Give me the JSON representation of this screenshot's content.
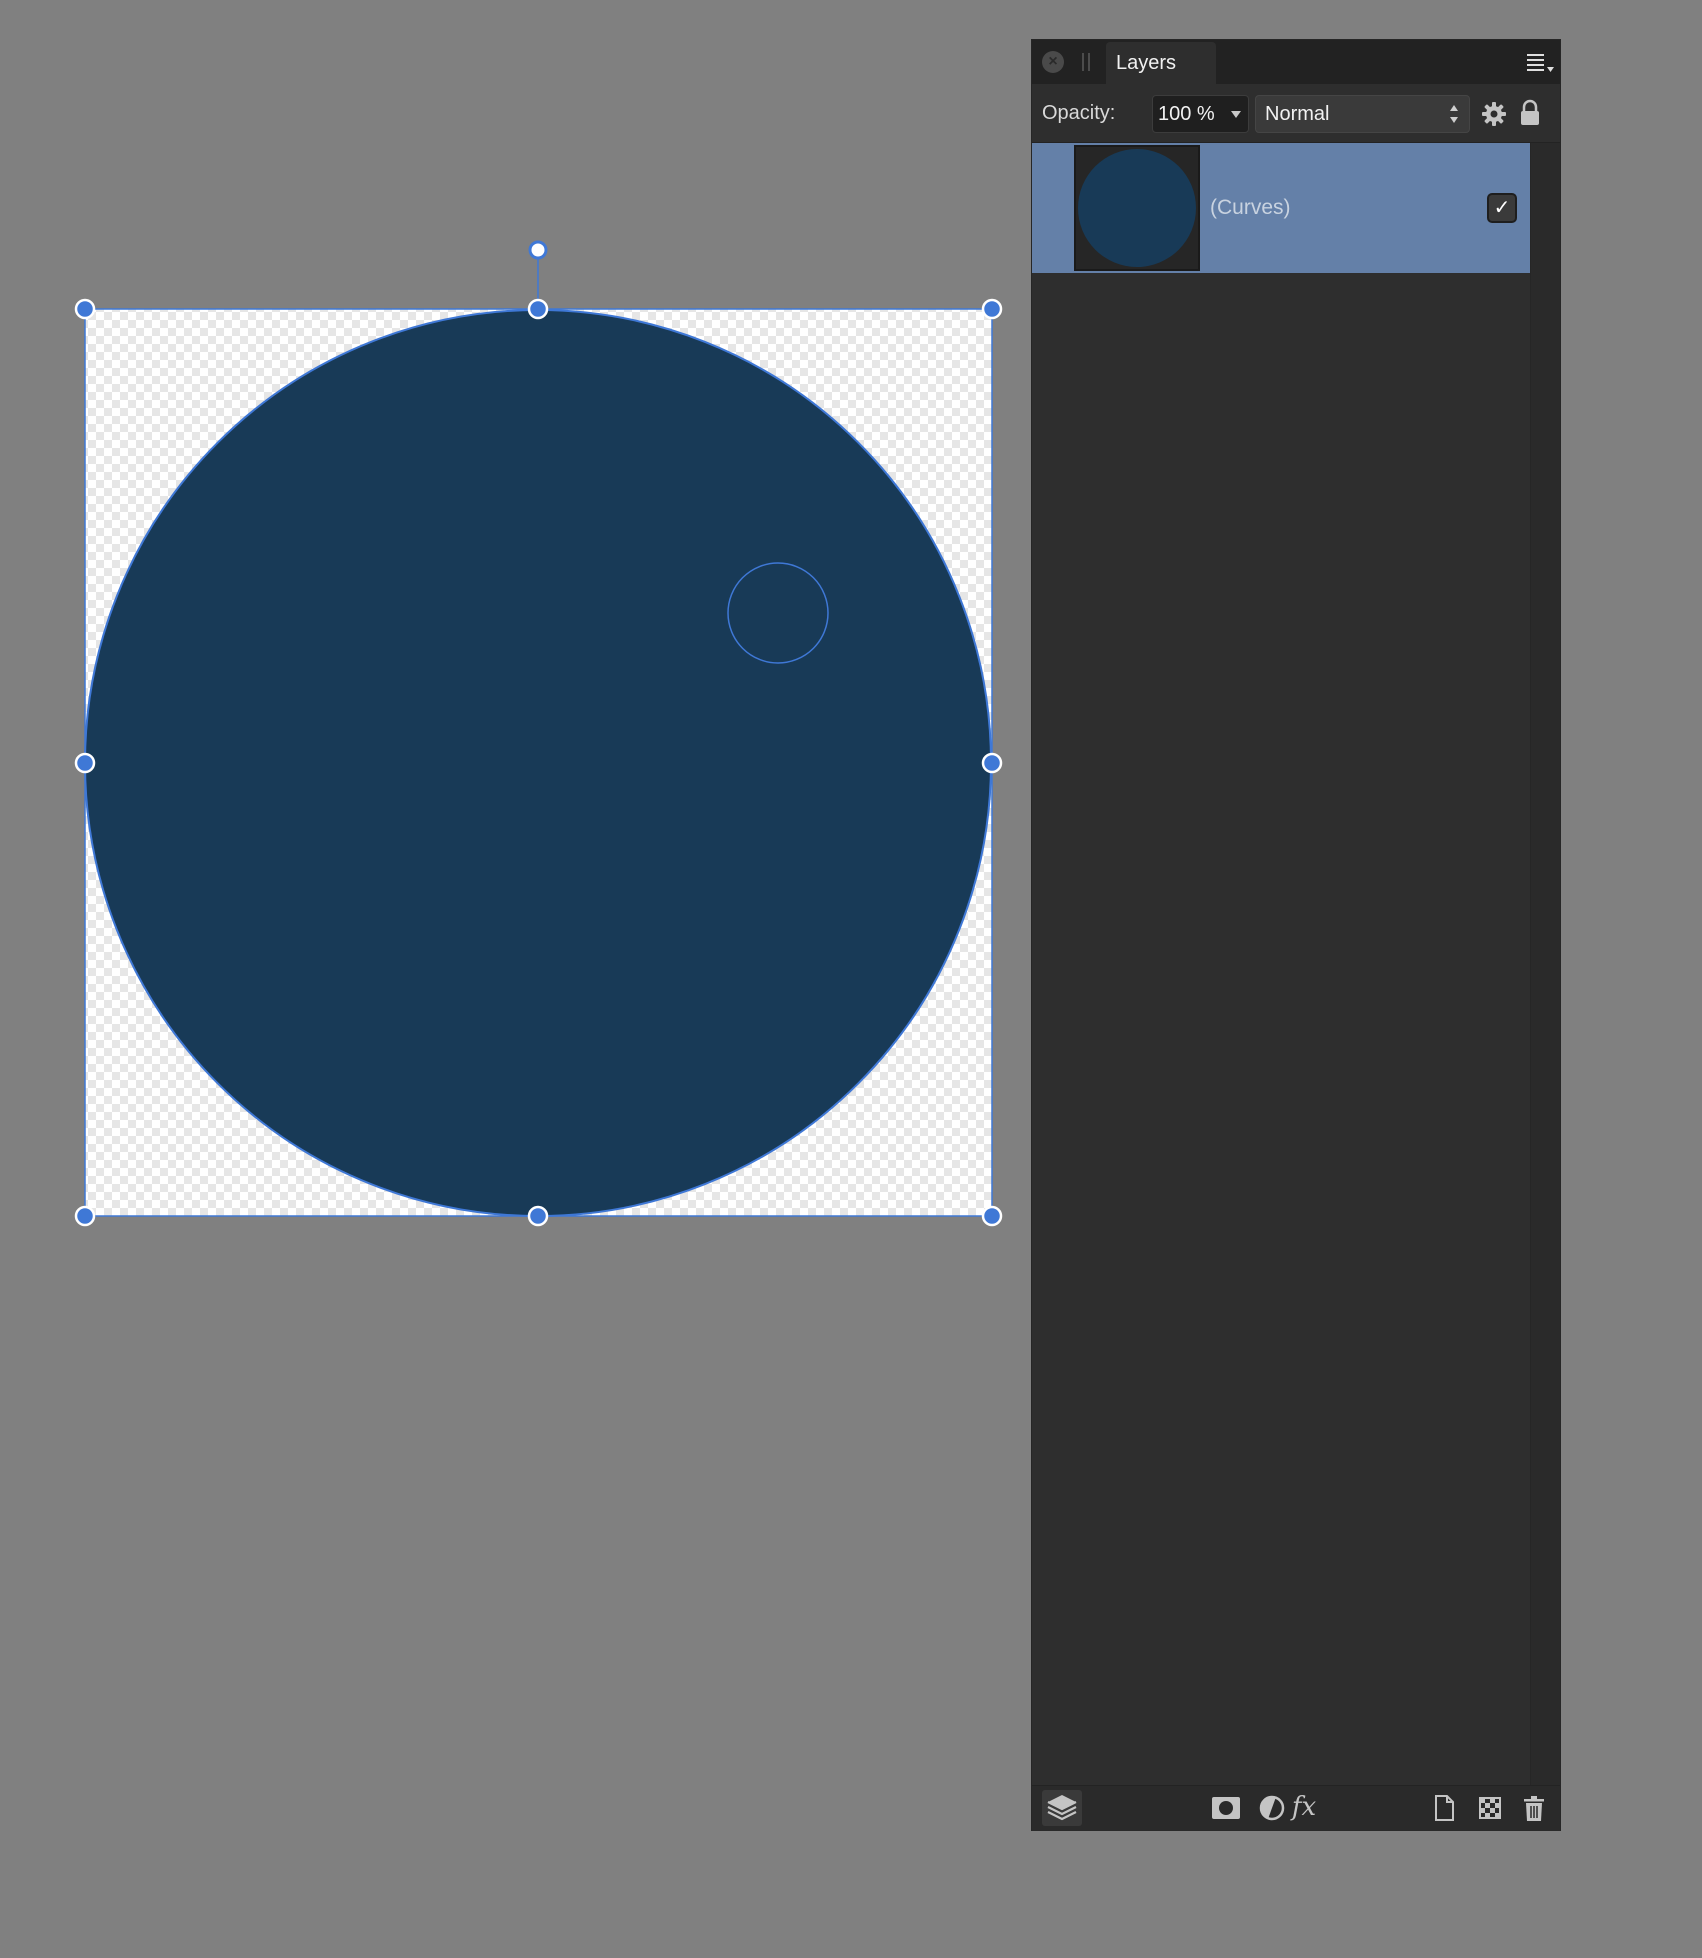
{
  "panel": {
    "tab_label": "Layers",
    "close_glyph": "×"
  },
  "options": {
    "opacity_label": "Opacity:",
    "opacity_value": "100 %",
    "blend_mode": "Normal"
  },
  "layers": [
    {
      "name": "(Curves)",
      "visible": true,
      "visibility_glyph": "✓",
      "selected": true
    }
  ],
  "footer": {
    "fx_label": "fx",
    "icons": [
      "layers-stack-icon",
      "mask-icon",
      "adjustment-icon",
      "fx-icon",
      "new-layer-icon",
      "pixel-layer-icon",
      "trash-icon"
    ]
  },
  "colors": {
    "canvas_background": "#808080",
    "shape_fill": "#183a57",
    "selection_accent": "#3f78d6",
    "panel_background": "#2e2e2e",
    "selected_row": "#6480a8"
  }
}
